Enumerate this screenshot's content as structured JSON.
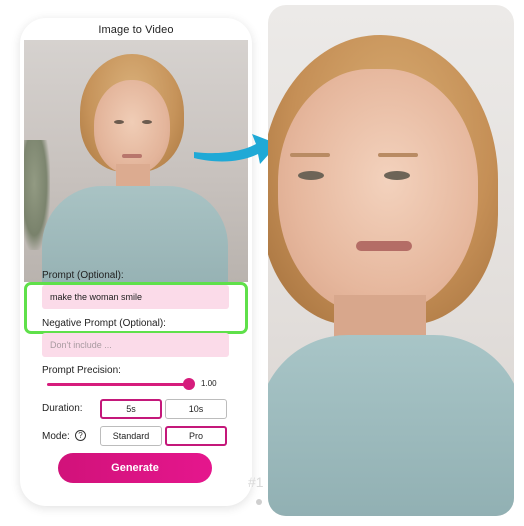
{
  "phone": {
    "title": "Image to Video",
    "prompt_label": "Prompt (Optional):",
    "prompt_value": "make the woman smile",
    "negative_label": "Negative Prompt (Optional):",
    "negative_placeholder": "Don't include ...",
    "precision_label": "Prompt Precision:",
    "precision_value": "1.00",
    "precision_level": 1.0,
    "duration_label": "Duration:",
    "duration_options": [
      "5s",
      "10s"
    ],
    "duration_selected": "5s",
    "mode_label": "Mode:",
    "mode_options": [
      "Standard",
      "Pro"
    ],
    "mode_selected": "Pro",
    "generate_label": "Generate"
  },
  "overlay": {
    "watermark": "#1"
  },
  "colors": {
    "accent": "#d61c7c",
    "highlight_border": "#5fe04a",
    "arrow": "#1fa9d6",
    "input_bg": "#fbdbe9"
  },
  "icons": {
    "help": "question-circle-icon",
    "arrow": "right-arrow-icon"
  }
}
